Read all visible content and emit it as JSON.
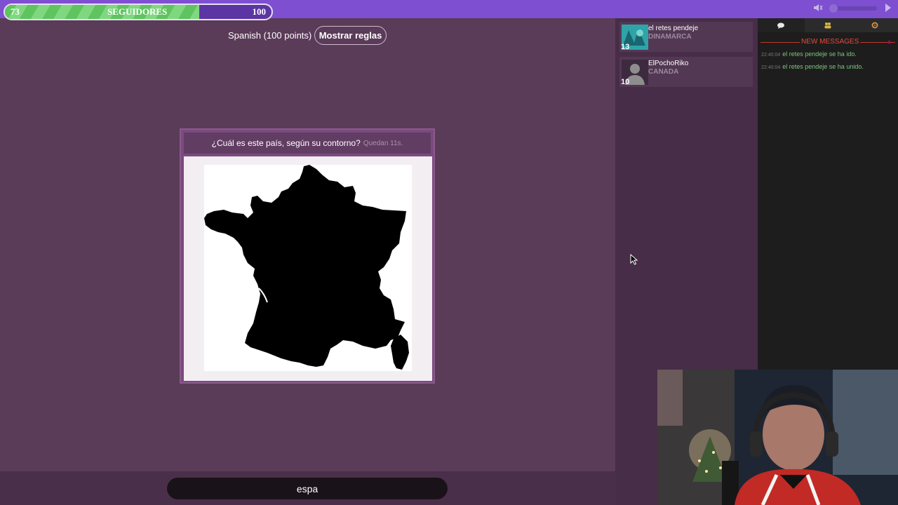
{
  "followers": {
    "current": "73",
    "title": "SEGUIDORES",
    "goal": "100",
    "progress": 0.73
  },
  "game": {
    "language_label": "Spanish (100 points)",
    "rules_button": "Mostrar reglas",
    "question": "¿Cuál es este país, según su contorno?",
    "timer": "Quedan 11s."
  },
  "answer": {
    "value": "espa"
  },
  "players": [
    {
      "name": "el retes pendeje",
      "country": "DINAMARCA",
      "score": "13"
    },
    {
      "name": "ElPochoRiko",
      "country": "CANADA",
      "score": "10"
    }
  ],
  "chat": {
    "tabs": [
      {
        "icon": "chat-bubble-icon"
      },
      {
        "icon": "users-icon"
      },
      {
        "icon": "settings-icon"
      }
    ],
    "new_messages_label": "NEW MESSAGES",
    "messages": [
      {
        "time": "22:40:04",
        "text": "el retes pendeje se ha ido."
      },
      {
        "time": "22:40:04",
        "text": "el retes pendeje se ha unido."
      }
    ]
  },
  "colors": {
    "background": "#5a3b58",
    "topbar": "#7e4fd1",
    "progress": "#5fc45f",
    "chat_system": "#7fc27f",
    "new_messages": "#e74c3c"
  }
}
